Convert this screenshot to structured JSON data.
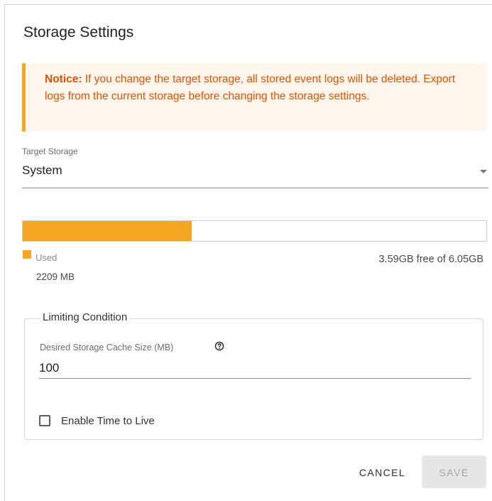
{
  "dialog": {
    "title": "Storage Settings",
    "notice": {
      "prefix": "Notice:",
      "text": " If you change the target storage, all stored event logs will be deleted. Export logs from the current storage before changing the storage settings."
    },
    "target_storage": {
      "label": "Target Storage",
      "value": "System"
    },
    "usage": {
      "used_fraction": 0.365,
      "used_label": "Used",
      "used_value": "2209 MB",
      "free_text": "3.59GB free of 6.05GB"
    },
    "limiting_condition": {
      "legend": "Limiting Condition",
      "cache_label": "Desired Storage Cache Size (MB)",
      "cache_value": "100",
      "ttl_label": "Enable Time to Live",
      "ttl_checked": false
    },
    "buttons": {
      "cancel": "CANCEL",
      "save": "SAVE"
    }
  },
  "colors": {
    "accent": "#f5a623",
    "notice_text": "#e65100",
    "notice_bg": "#fff7ee"
  },
  "icons": {
    "dropdown": "caret-down-icon",
    "help": "help-circle-icon"
  }
}
